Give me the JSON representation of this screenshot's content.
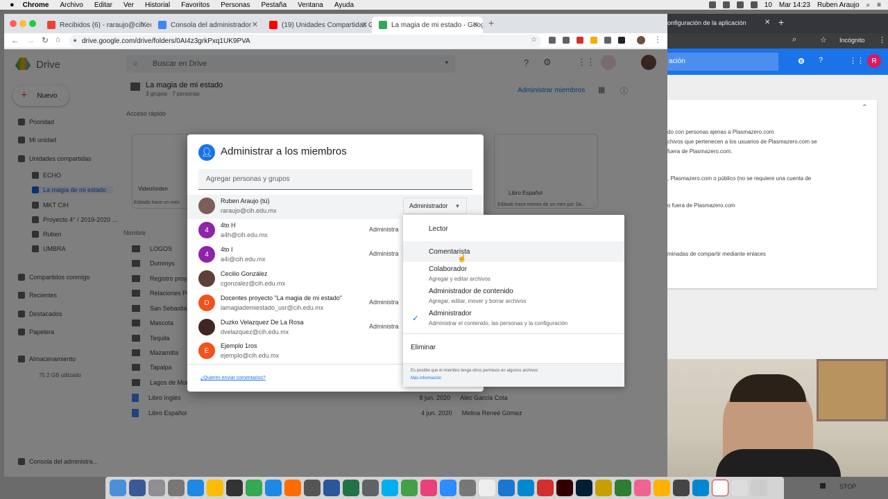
{
  "menubar": {
    "app": "Chrome",
    "items": [
      "Archivo",
      "Editar",
      "Ver",
      "Historial",
      "Favoritos",
      "Personas",
      "Pestaña",
      "Ventana",
      "Ayuda"
    ],
    "battery": "10",
    "clock": "Mar 14:23",
    "user": "Ruben Araujo"
  },
  "browser": {
    "tabs": [
      {
        "label": "Recibidos (6) - raraujo@cih.edu",
        "color": "#ea4335"
      },
      {
        "label": "Consola del administrador",
        "color": "#4285f4"
      },
      {
        "label": "(19) Unidades Compartidas Go",
        "color": "#ff0000"
      },
      {
        "label": "La magia de mi estado - Googl",
        "color": "#34a853"
      }
    ],
    "url": "drive.google.com/drive/folders/0AI4z3grkPxq1UK9PVA"
  },
  "drive": {
    "logo": "Drive",
    "search_placeholder": "Buscar en Drive",
    "new_label": "Nuevo",
    "folder_title": "La magia de mi estado",
    "folder_sub": "3 grupos · 7 personas",
    "manage_members": "Administrar miembros",
    "quick_access": "Acceso rápido",
    "card1": {
      "title": "Video/orden",
      "sub": "Editado hace un mes"
    },
    "card2": {
      "title": "Libro Español",
      "sub": "Editado hace menos de un mes por Sa..."
    },
    "name_header": "Nombre",
    "nav": [
      "Prioridad",
      "Mi unidad",
      "Unidades compartidas",
      "ECHO",
      "La magia de mi estado",
      "MKT CIH",
      "Proyecto 4° / 2019-2020 ...",
      "Ruben",
      "UMBRA",
      "Compartidos conmigo",
      "Recientes",
      "Destacados",
      "Papelera",
      "Almacenamiento",
      "75.2 GB utilizado",
      "Consola del administra..."
    ],
    "files": [
      "LOGOS",
      "Dummys",
      "Registro proye",
      "Relaciones Pu",
      "San Sebastián",
      "Mascota",
      "Tequila",
      "Mazamitla",
      "Tapalpa",
      "Lagos de More",
      "Libro Inglés",
      "Libro Español"
    ],
    "file_meta": [
      {
        "date": "8 jun. 2020",
        "owner": "Alec García Cota"
      },
      {
        "date": "4 jun. 2020",
        "owner": "Melina Reneé Gómez"
      }
    ]
  },
  "win2": {
    "tab_label": "onfiguración de la aplicación",
    "incognito": "Incógnito",
    "header": "ación",
    "avatar": "R",
    "lines": [
      "do con personas ajenas a Plasmazero.com",
      "chivos que pertenecen a los usuarios de Plasmazero.com se",
      "fuera de Plasmazero.com.",
      ", Plasmazero.com o público (no se requiere una cuenta de",
      "o fuera de Plasmazero.com",
      "minadas de compartir mediante enlaces"
    ]
  },
  "dialog": {
    "title": "Administrar a los miembros",
    "add_placeholder": "Agregar personas y grupos",
    "role_button": "Administrador",
    "feedback": "¿Quieres enviar comentarios?",
    "members": [
      {
        "name": "Ruben Araujo (tú)",
        "email": "raraujo@cih.edu.mx",
        "role": "",
        "initial": "",
        "color": "#7b5e57"
      },
      {
        "name": "4to H",
        "email": "a4h@cih.edu.mx",
        "role": "Administra",
        "initial": "4",
        "color": "#8e24aa"
      },
      {
        "name": "4to I",
        "email": "a4i@cih.edu.mx",
        "role": "Administra",
        "initial": "4",
        "color": "#8e24aa"
      },
      {
        "name": "Cecilio González",
        "email": "cgonzalez@cih.edu.mx",
        "role": "",
        "initial": "",
        "color": "#5d4037"
      },
      {
        "name": "Docentes proyecto \"La magia de mi estado\"",
        "email": "lamagiademiestado_usr@cih.edu.mx",
        "role": "Administra",
        "initial": "D",
        "color": "#f4511e"
      },
      {
        "name": "Duzko Velazquez De La Rosa",
        "email": "dvelazquez@cih.edu.mx",
        "role": "Administra",
        "initial": "",
        "color": "#3e2723"
      },
      {
        "name": "Ejemplo 1ros",
        "email": "ejemplo@cih.edu.mx",
        "role": "",
        "initial": "E",
        "color": "#f4511e"
      }
    ]
  },
  "role_menu": {
    "items": [
      {
        "label": "Lector",
        "desc": ""
      },
      {
        "label": "Comentarista",
        "desc": ""
      },
      {
        "label": "Colaborador",
        "desc": "Agregar y editar archivos"
      },
      {
        "label": "Administrador de contenido",
        "desc": "Agregar, editar, mover y borrar archivos"
      },
      {
        "label": "Administrador",
        "desc": "Administrar el contenido, las personas y la configuración",
        "checked": true
      }
    ],
    "remove": "Eliminar",
    "note": "Es posible que el miembro tenga otros permisos en algunos archivos",
    "more_info": "Más información"
  },
  "dock": {
    "stop_label": "STOP"
  }
}
